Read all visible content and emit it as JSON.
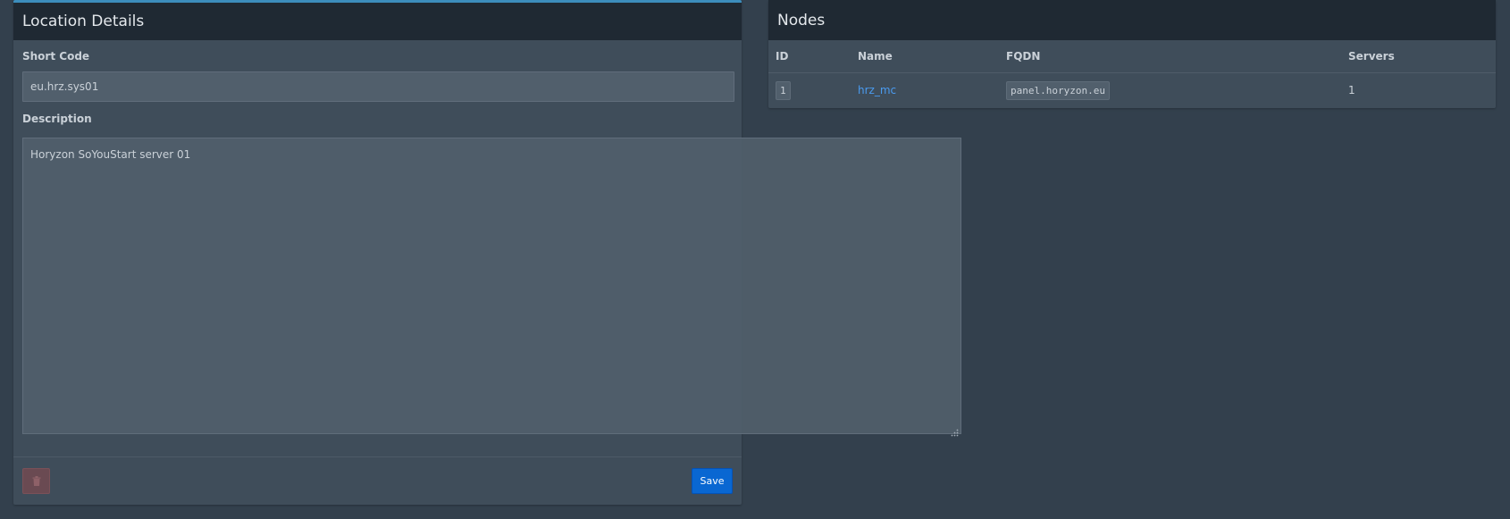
{
  "location_box": {
    "title": "Location Details",
    "short_code": {
      "label": "Short Code",
      "value": "eu.hrz.sys01"
    },
    "description": {
      "label": "Description",
      "value": "Horyzon SoYouStart server 01"
    },
    "save_label": "Save",
    "delete_icon": "trash-icon"
  },
  "nodes_box": {
    "title": "Nodes",
    "columns": [
      "ID",
      "Name",
      "FQDN",
      "Servers"
    ],
    "rows": [
      {
        "id": "1",
        "name": "hrz_mc",
        "fqdn": "panel.horyzon.eu",
        "servers": "1"
      }
    ]
  },
  "colors": {
    "background": "#33404d",
    "box": "#3f4d5a",
    "header": "#1f2933",
    "accent": "#3c8dbc",
    "save": "#0967d2",
    "link": "#4a9bf0",
    "danger": "#6a4a52"
  }
}
